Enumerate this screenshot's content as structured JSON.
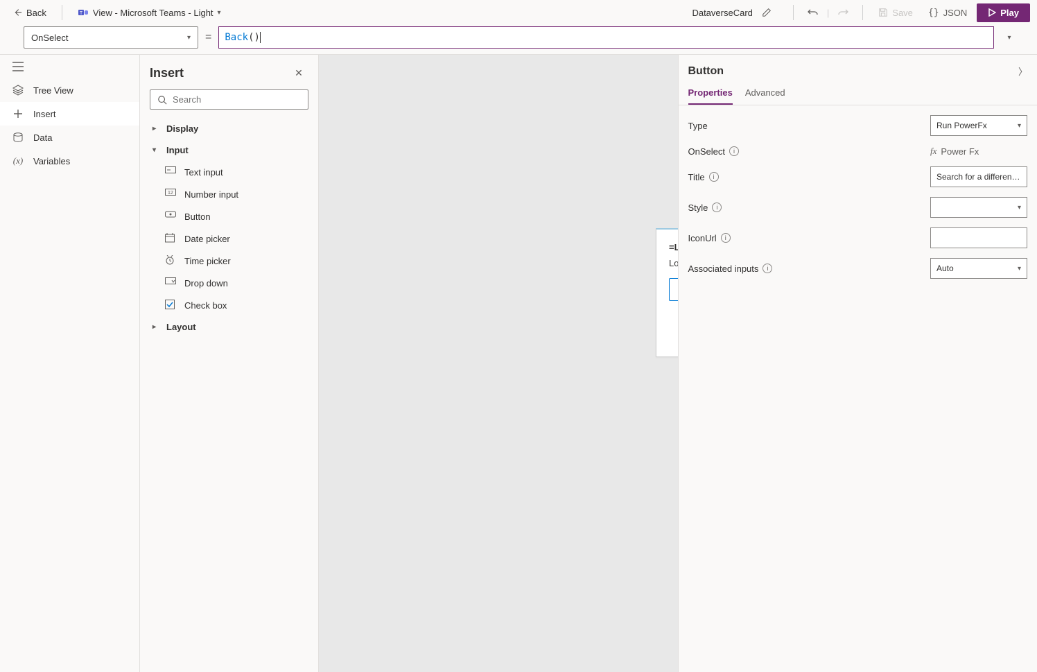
{
  "topbar": {
    "back_label": "Back",
    "view_label": "View - Microsoft Teams - Light",
    "card_name": "DataverseCard",
    "save_label": "Save",
    "json_label": "JSON",
    "play_label": "Play"
  },
  "formulaBar": {
    "property_selected": "OnSelect",
    "formula_fn": "Back",
    "formula_rest": "()"
  },
  "leftnav": {
    "items": [
      {
        "label": "Tree View",
        "icon": "layers-icon"
      },
      {
        "label": "Insert",
        "icon": "plus-icon",
        "active": true
      },
      {
        "label": "Data",
        "icon": "database-icon"
      },
      {
        "label": "Variables",
        "icon": "variable-icon"
      }
    ]
  },
  "insertPanel": {
    "title": "Insert",
    "search_placeholder": "Search",
    "categories": [
      {
        "label": "Display",
        "open": false
      },
      {
        "label": "Input",
        "open": true,
        "items": [
          {
            "label": "Text input",
            "icon": "textinput-icon"
          },
          {
            "label": "Number input",
            "icon": "numberinput-icon"
          },
          {
            "label": "Button",
            "icon": "button-icon"
          },
          {
            "label": "Date picker",
            "icon": "calendar-icon"
          },
          {
            "label": "Time picker",
            "icon": "clock-icon"
          },
          {
            "label": "Drop down",
            "icon": "dropdown-icon"
          },
          {
            "label": "Check box",
            "icon": "checkbox-icon"
          }
        ]
      },
      {
        "label": "Layout",
        "open": false
      }
    ]
  },
  "canvas": {
    "card": {
      "line1": "=LookUp(account, 'Account Name' = EnteredAccountName).'Account Name'",
      "line2": "LookUp(account, 'Account Name' = EnteredAccountName).'Account Number'",
      "button_label": "Search for a different account"
    }
  },
  "propPanel": {
    "title": "Button",
    "tabs": {
      "properties": "Properties",
      "advanced": "Advanced"
    },
    "rows": {
      "type": {
        "label": "Type",
        "value": "Run PowerFx"
      },
      "onselect": {
        "label": "OnSelect",
        "value": "Power Fx"
      },
      "title": {
        "label": "Title",
        "value": "Search for a different account"
      },
      "style": {
        "label": "Style",
        "value": ""
      },
      "iconurl": {
        "label": "IconUrl",
        "value": ""
      },
      "assoc": {
        "label": "Associated inputs",
        "value": "Auto"
      }
    }
  }
}
